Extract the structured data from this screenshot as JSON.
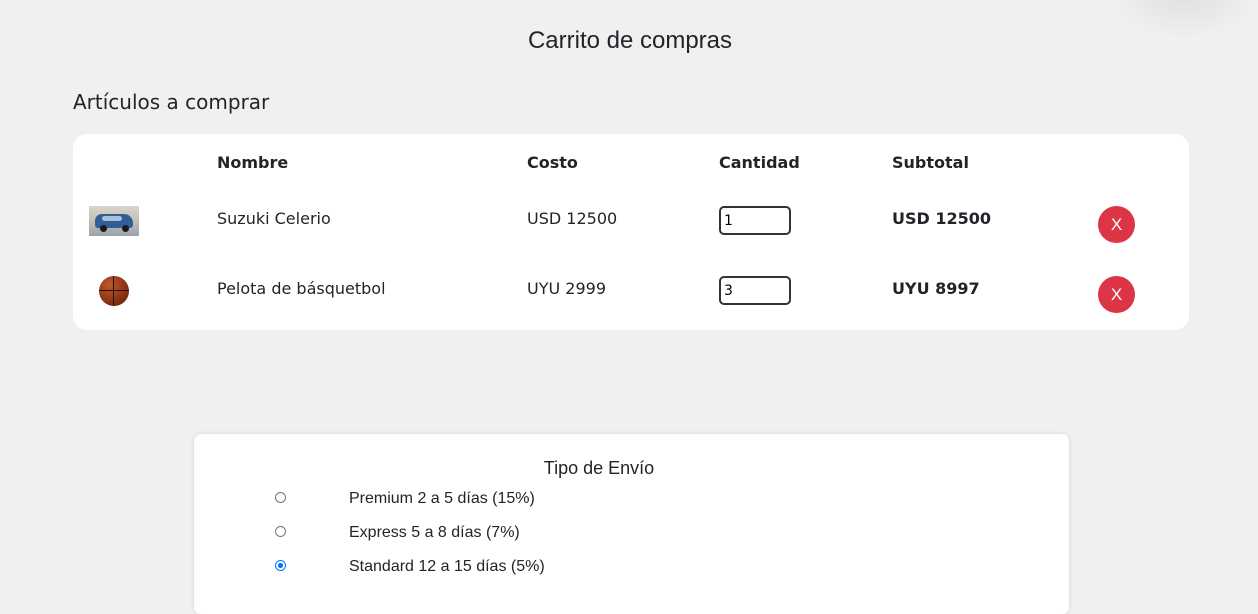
{
  "page": {
    "title": "Carrito de compras",
    "section_title": "Artículos a comprar"
  },
  "cart": {
    "headers": {
      "name": "Nombre",
      "cost": "Costo",
      "quantity": "Cantidad",
      "subtotal": "Subtotal"
    },
    "items": [
      {
        "image_icon": "car-thumbnail",
        "name": "Suzuki Celerio",
        "cost": "USD 12500",
        "quantity": "1",
        "subtotal": "USD 12500",
        "remove_label": "X"
      },
      {
        "image_icon": "basketball-thumbnail",
        "name": "Pelota de básquetbol",
        "cost": "UYU 2999",
        "quantity": "3",
        "subtotal": "UYU 8997",
        "remove_label": "X"
      }
    ]
  },
  "shipping": {
    "title": "Tipo de Envío",
    "options": [
      {
        "label": "Premium 2 a 5 días (15%)",
        "selected": false
      },
      {
        "label": "Express 5 a 8 días (7%)",
        "selected": false
      },
      {
        "label": "Standard 12 a 15 días (5%)",
        "selected": true
      }
    ]
  },
  "colors": {
    "page_background": "#f0f0f0",
    "card_background": "#ffffff",
    "remove_button": "#dc3545",
    "radio_selected": "#0075ff"
  }
}
